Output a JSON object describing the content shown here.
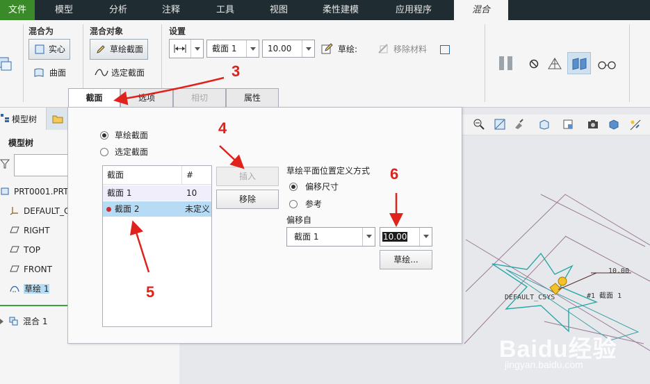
{
  "menubar": {
    "tabs": [
      "文件",
      "模型",
      "分析",
      "注释",
      "工具",
      "视图",
      "柔性建模",
      "应用程序",
      "混合"
    ]
  },
  "ribbon": {
    "blend_as_title": "混合为",
    "solid_label": "实心",
    "surface_label": "曲面",
    "blend_object_title": "混合对象",
    "sketched_section_label": "草绘截面",
    "selected_section_label": "选定截面",
    "settings_title": "设置",
    "section_combo": "截面 1",
    "offset_combo": "10.00",
    "sketch_label": "草绘:",
    "remove_material_label": "移除材料"
  },
  "dashboard_tabs": [
    "截面",
    "选项",
    "相切",
    "属性"
  ],
  "left_panel": {
    "tabs": [
      "模型树"
    ],
    "title": "模型树",
    "items": [
      "PRT0001.PRT",
      "DEFAULT_C",
      "RIGHT",
      "TOP",
      "FRONT",
      "草绘 1",
      "混合 1"
    ]
  },
  "panel": {
    "radio_sketched": "草绘截面",
    "radio_selected": "选定截面",
    "table": {
      "headers": [
        "截面",
        "#"
      ],
      "rows": [
        {
          "section": "截面 1",
          "num": "10"
        },
        {
          "section": "截面 2",
          "num": "未定义"
        }
      ]
    },
    "insert_button": "插入",
    "remove_button": "移除",
    "plane_def_title": "草绘平面位置定义方式",
    "radio_offset": "偏移尺寸",
    "radio_reference": "参考",
    "offset_from_label": "偏移自",
    "offset_from_value": "截面 1",
    "offset_value": "10.00",
    "sketch_button": "草绘..."
  },
  "annotations": [
    "3",
    "4",
    "5",
    "6"
  ],
  "graphics": {
    "dim_label": "10.00",
    "csys_label": "DEFAULT_CSYS",
    "section_label": "#1 截面 1"
  },
  "watermark": {
    "brand": "Baidu经验",
    "url": "jingyan.baidu.com"
  },
  "colors": {
    "menubar_bg": "#1f2d33",
    "file_tab": "#3a8a2a",
    "selection": "#b6dcf5",
    "annotation_red": "#e0221d",
    "sketch_cyan": "#2aa7a7"
  }
}
